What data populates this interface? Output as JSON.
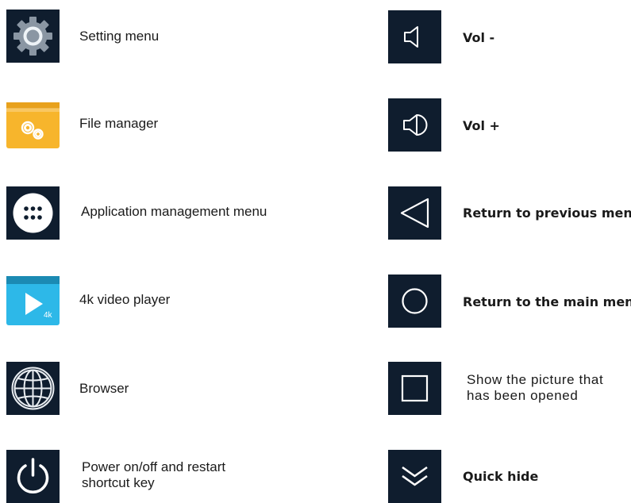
{
  "left_items": [
    {
      "icon": "gear-icon",
      "label": "Setting menu"
    },
    {
      "icon": "folder-gears-icon",
      "label": "File manager"
    },
    {
      "icon": "apps-grid-icon",
      "label": "Application management menu"
    },
    {
      "icon": "video-player-icon",
      "label": "4k video player",
      "badge": "4k"
    },
    {
      "icon": "globe-icon",
      "label": "Browser"
    },
    {
      "icon": "power-icon",
      "label_lines": [
        "Power on/off and restart",
        "shortcut key"
      ]
    }
  ],
  "right_items": [
    {
      "icon": "volume-down-icon",
      "label": "Vol -"
    },
    {
      "icon": "volume-up-icon",
      "label": "Vol +"
    },
    {
      "icon": "back-triangle-icon",
      "label": "Return to previous menu"
    },
    {
      "icon": "home-circle-icon",
      "label": "Return to the main menu"
    },
    {
      "icon": "recent-square-icon",
      "label_lines": [
        "Show the picture that",
        "has been opened"
      ]
    },
    {
      "icon": "chevron-down-icon",
      "label": "Quick hide"
    }
  ],
  "colors": {
    "tile_background": "#0f1d2e",
    "folder_yellow": "#f7b52c",
    "video_blue": "#2db8e8",
    "text": "#1a1a1a"
  }
}
